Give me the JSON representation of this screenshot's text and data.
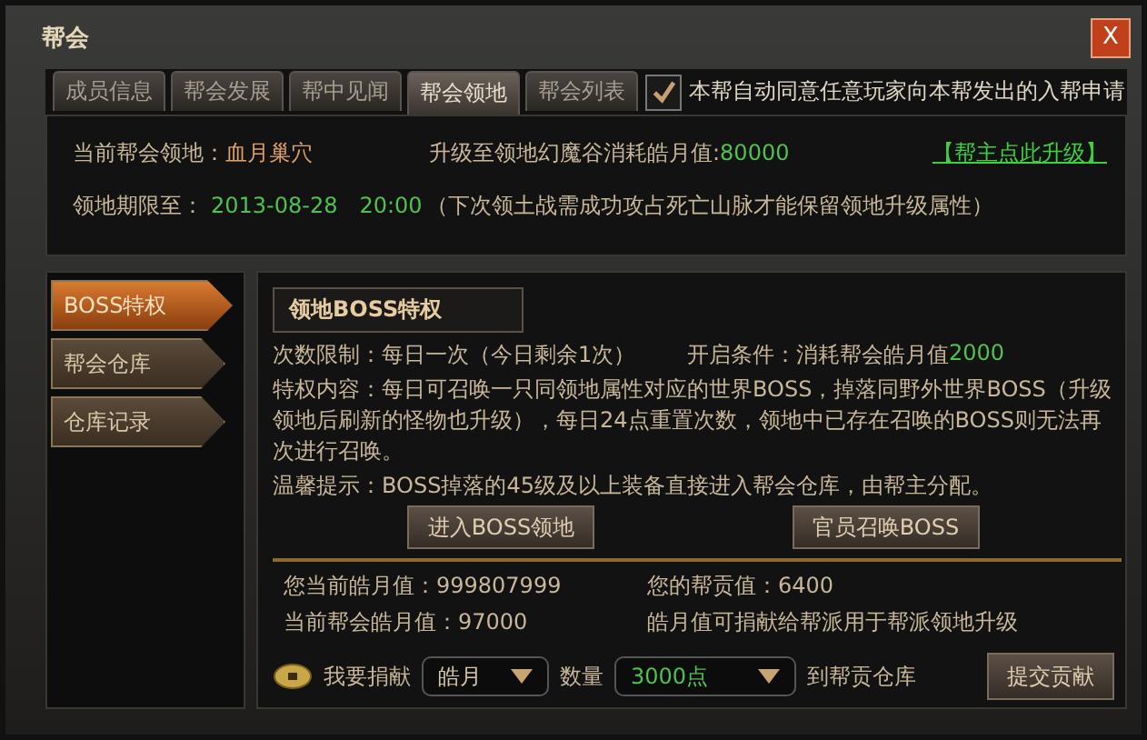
{
  "window": {
    "title": "帮会",
    "close": "X"
  },
  "tabs": [
    {
      "label": "成员信息",
      "selected": false
    },
    {
      "label": "帮会发展",
      "selected": false
    },
    {
      "label": "帮中见闻",
      "selected": false
    },
    {
      "label": "帮会领地",
      "selected": true
    },
    {
      "label": "帮会列表",
      "selected": false
    }
  ],
  "auto_accept": {
    "label": "本帮自动同意任意玩家向本帮发出的入帮申请",
    "checked": true
  },
  "territory": {
    "current_label": "当前帮会领地：",
    "current_value": "血月巢穴",
    "upgrade_label": "升级至领地幻魔谷消耗皓月值:",
    "upgrade_value": "80000",
    "upgrade_link": "【帮主点此升级】",
    "expire_label": "领地期限至：",
    "expire_value": "2013-08-28　20:00",
    "expire_note": "（下次领土战需成功攻占死亡山脉才能保留领地升级属性）"
  },
  "sidebar": {
    "items": [
      {
        "label": "BOSS特权",
        "selected": true
      },
      {
        "label": "帮会仓库",
        "selected": false
      },
      {
        "label": "仓库记录",
        "selected": false
      }
    ]
  },
  "boss": {
    "title": "领地BOSS特权",
    "limit": "次数限制：每日一次（今日剩余1次）",
    "condition_label": "开启条件：消耗帮会皓月值",
    "condition_value": "2000",
    "content": "特权内容：每日可召唤一只同领地属性对应的世界BOSS，掉落同野外世界BOSS（升级领地后刷新的怪物也升级），每日24点重置次数，领地中已存在召唤的BOSS则无法再次进行召唤。",
    "tip": "温馨提示：BOSS掉落的45级及以上装备直接进入帮会仓库，由帮主分配。",
    "buttons": [
      "进入BOSS领地",
      "官员召唤BOSS"
    ]
  },
  "stats": [
    {
      "label": "您当前皓月值：",
      "value": "999807999"
    },
    {
      "label": "您的帮贡值：",
      "value": "6400"
    },
    {
      "label": "当前帮会皓月值：",
      "value": "97000"
    },
    {
      "label": "皓月值可捐献给帮派用于帮派领地升级"
    }
  ],
  "donate": {
    "label": "我要捐献",
    "currency": "皓月",
    "amount_label": "数量",
    "amount": "3000点",
    "target": "到帮贡仓库",
    "submit": "提交贡献"
  }
}
